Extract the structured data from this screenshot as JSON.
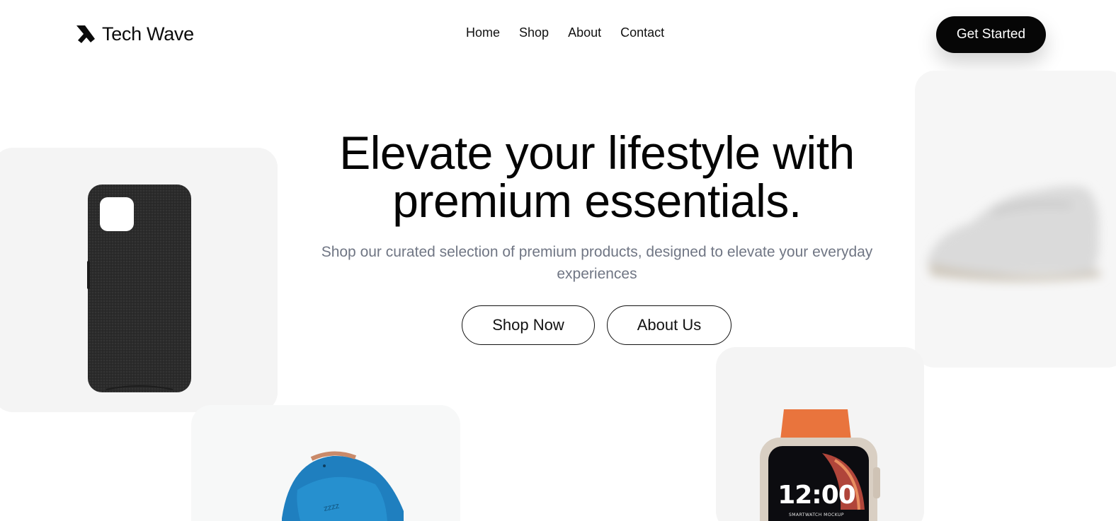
{
  "brand": {
    "name": "Tech Wave",
    "logo_icon": "arrow-bird-logo"
  },
  "nav": {
    "items": [
      "Home",
      "Shop",
      "About",
      "Contact"
    ]
  },
  "header": {
    "cta_label": "Get Started"
  },
  "hero": {
    "title_line1": "Elevate your lifestyle with",
    "title_line2": "premium essentials.",
    "subtitle": "Shop our curated selection of premium products, designed to elevate your everyday experiences",
    "primary_button": "Shop Now",
    "secondary_button": "About Us"
  },
  "products": {
    "watch_time": "12:00",
    "watch_caption": "SMARTWATCH MOCKUP"
  },
  "colors": {
    "background": "#ffffff",
    "text": "#0b0b0b",
    "subtitle": "#707684",
    "cta_bg": "#060606",
    "card_bg": "#f4f4f4",
    "watch_band": "#e9743d",
    "headband_blue": "#1f7fbf"
  }
}
